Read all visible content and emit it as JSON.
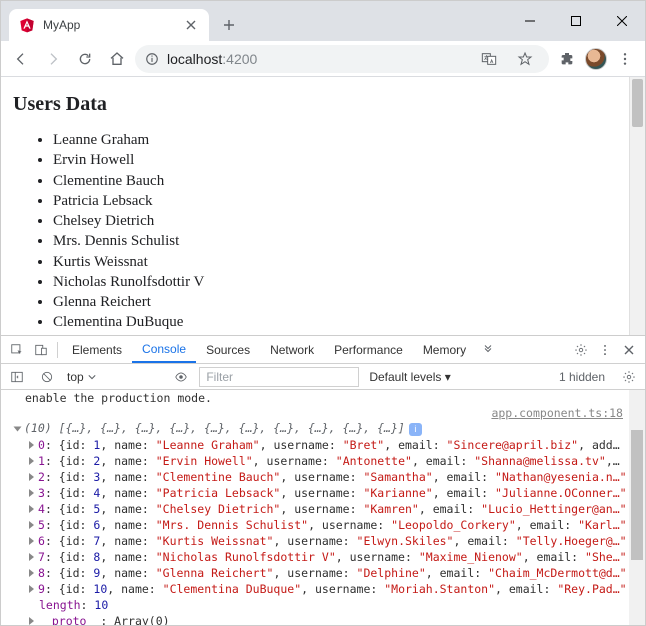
{
  "window": {
    "tab_title": "MyApp",
    "url_host": "localhost",
    "url_path": ":4200"
  },
  "page": {
    "heading": "Users Data",
    "users": [
      "Leanne Graham",
      "Ervin Howell",
      "Clementine Bauch",
      "Patricia Lebsack",
      "Chelsey Dietrich",
      "Mrs. Dennis Schulist",
      "Kurtis Weissnat",
      "Nicholas Runolfsdottir V",
      "Glenna Reichert",
      "Clementina DuBuque"
    ]
  },
  "devtools": {
    "tabs": [
      "Elements",
      "Console",
      "Sources",
      "Network",
      "Performance",
      "Memory"
    ],
    "active_tab": "Console",
    "context": "top",
    "filter_placeholder": "Filter",
    "levels_label": "Default levels ▾",
    "hidden_label": "1 hidden",
    "prod_mode_msg": "enable the production mode.",
    "source_link": "app.component.ts:18",
    "array_summary_prefix": "(10)",
    "array_summary_body": " [{…}, {…}, {…}, {…}, {…}, {…}, {…}, {…}, {…}, {…}]",
    "entries": [
      {
        "idx": 0,
        "id": 1,
        "name": "Leanne Graham",
        "username": "Bret",
        "email": "Sincere@april.biz",
        "tail": ", add…"
      },
      {
        "idx": 1,
        "id": 2,
        "name": "Ervin Howell",
        "username": "Antonette",
        "email": "Shanna@melissa.tv",
        "tail": ",…"
      },
      {
        "idx": 2,
        "id": 3,
        "name": "Clementine Bauch",
        "username": "Samantha",
        "email": "Nathan@yesenia.n…",
        "tail": ""
      },
      {
        "idx": 3,
        "id": 4,
        "name": "Patricia Lebsack",
        "username": "Karianne",
        "email": "Julianne.OConner…",
        "tail": ""
      },
      {
        "idx": 4,
        "id": 5,
        "name": "Chelsey Dietrich",
        "username": "Kamren",
        "email": "Lucio_Hettinger@an…",
        "tail": ""
      },
      {
        "idx": 5,
        "id": 6,
        "name": "Mrs. Dennis Schulist",
        "username": "Leopoldo_Corkery",
        "email": "Karl…",
        "tail": ""
      },
      {
        "idx": 6,
        "id": 7,
        "name": "Kurtis Weissnat",
        "username": "Elwyn.Skiles",
        "email": "Telly.Hoeger@…",
        "tail": ""
      },
      {
        "idx": 7,
        "id": 8,
        "name": "Nicholas Runolfsdottir V",
        "username": "Maxime_Nienow",
        "email": "She…",
        "tail": ""
      },
      {
        "idx": 8,
        "id": 9,
        "name": "Glenna Reichert",
        "username": "Delphine",
        "email": "Chaim_McDermott@d…",
        "tail": ""
      },
      {
        "idx": 9,
        "id": 10,
        "name": "Clementina DuBuque",
        "username": "Moriah.Stanton",
        "email": "Rey.Pad…",
        "tail": ""
      }
    ],
    "length_label": "length",
    "length_value": "10",
    "proto_label": "__proto__",
    "proto_value": "Array(0)"
  }
}
